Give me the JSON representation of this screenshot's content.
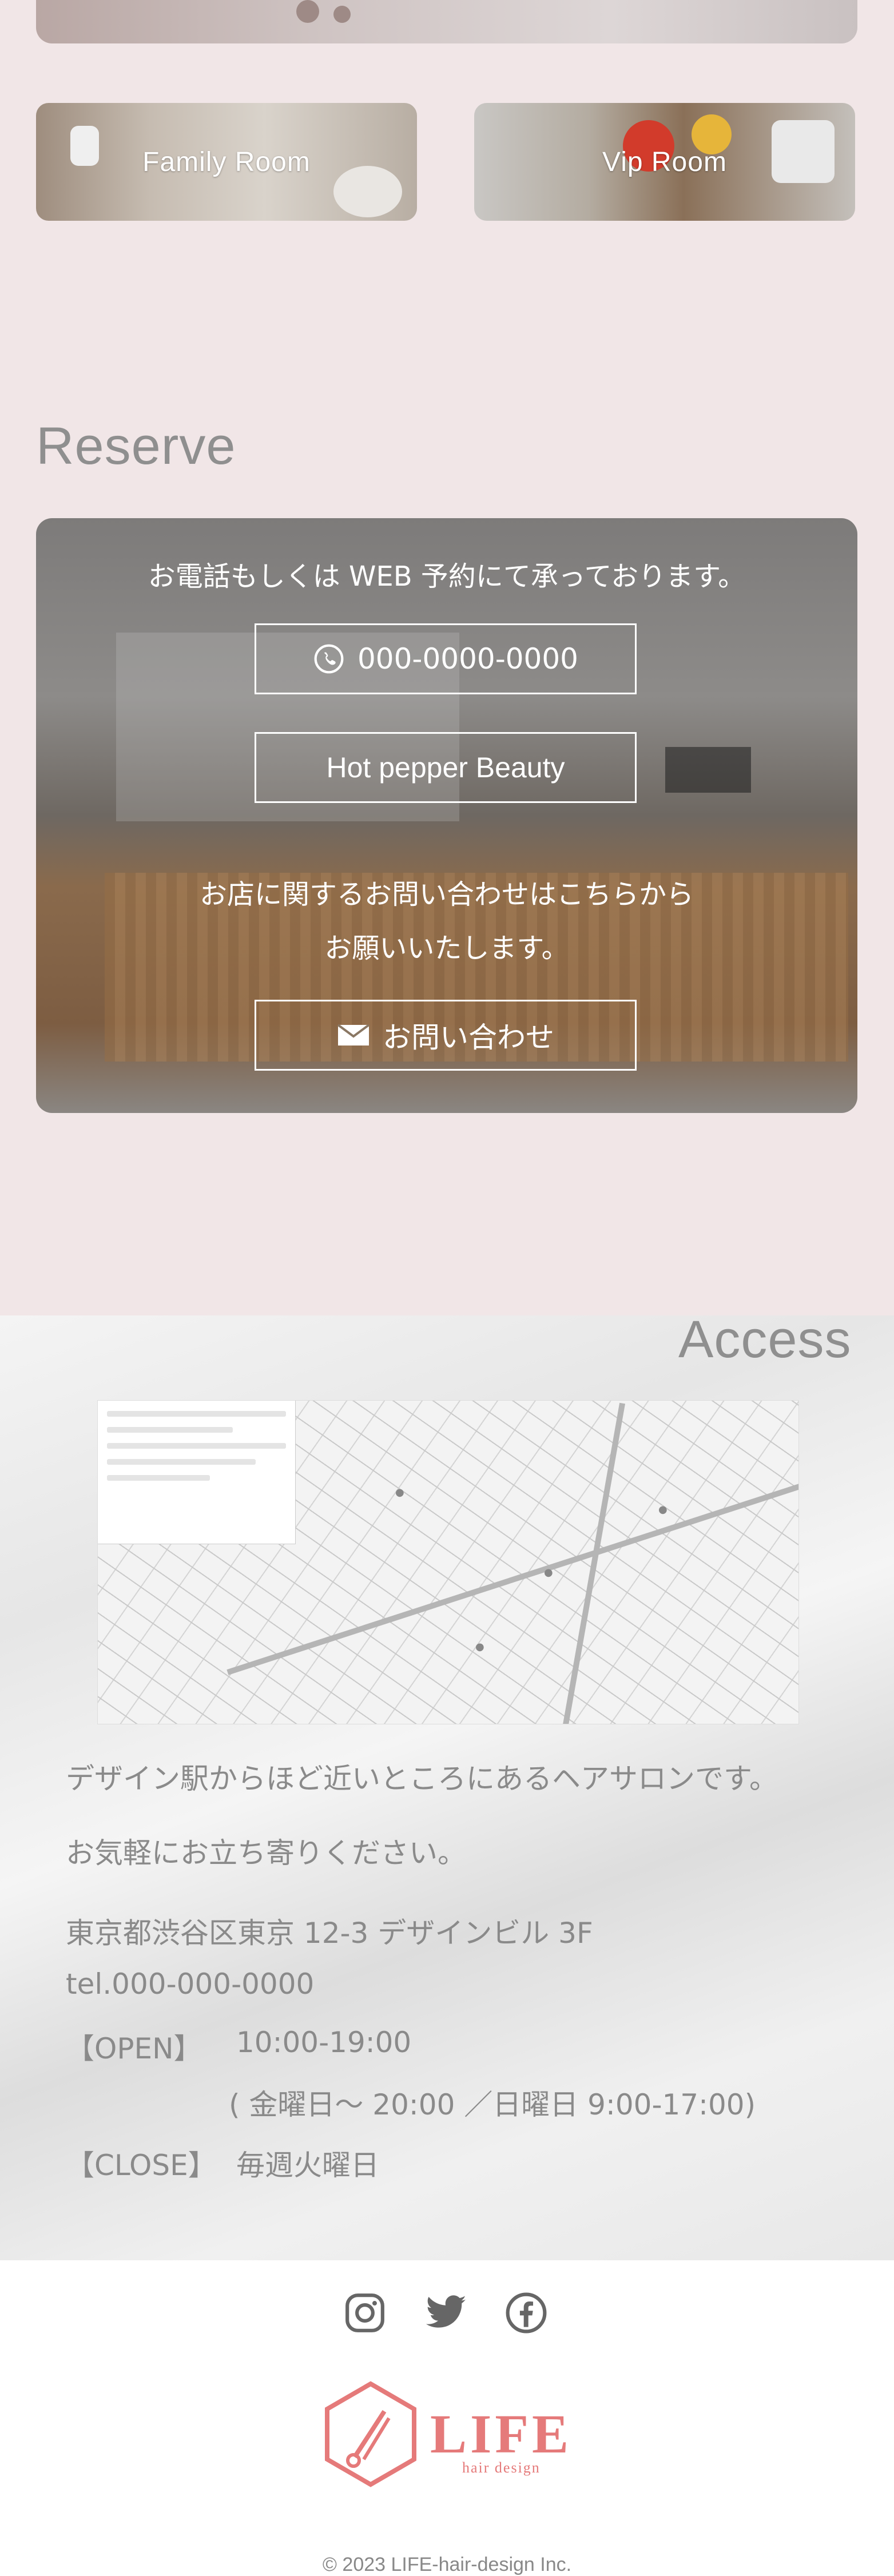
{
  "rooms": {
    "family_label": "Family Room",
    "vip_label": "Vip Room"
  },
  "reserve": {
    "heading": "Reserve",
    "intro": "お電話もしくは WEB 予約にて承っております。",
    "phone": "000-0000-0000",
    "hotpepper": "Hot pepper Beauty",
    "inquiry_line1": "お店に関するお問い合わせはこちらから",
    "inquiry_line2": "お願いいたします。",
    "contact": "お問い合わせ"
  },
  "access": {
    "heading": "Access",
    "desc1": "デザイン駅からほど近いところにあるヘアサロンです。",
    "desc2": "お気軽にお立ち寄りください。",
    "address": "東京都渋谷区東京 12-3 デザインビル 3F",
    "tel": "tel.000-000-0000",
    "open_label": "【OPEN】",
    "open_hours": "10:00-19:00",
    "open_note": "( 金曜日～ 20:00 ／日曜日 9:00-17:00)",
    "close_label": "【CLOSE】",
    "close_days": "毎週火曜日"
  },
  "footer": {
    "social": [
      "instagram-icon",
      "twitter-icon",
      "facebook-icon"
    ],
    "logo_name": "LIFE",
    "logo_sub": "hair design",
    "copyright": "© 2023 LIFE-hair-design Inc."
  },
  "colors": {
    "pink_bg": "#f1e6e7",
    "brand": "#e57a7a",
    "heading_gray": "#8f8f8f"
  }
}
